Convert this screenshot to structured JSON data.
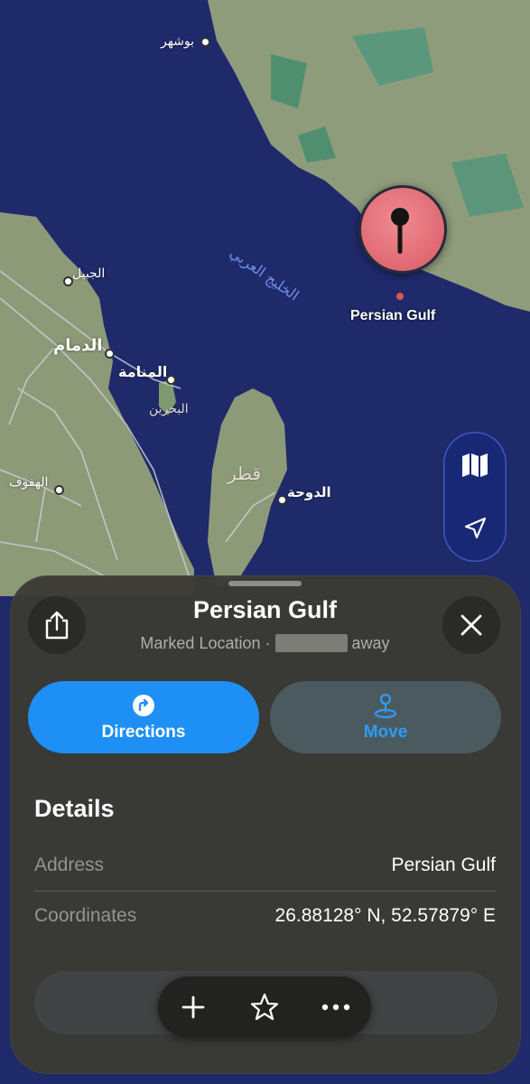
{
  "map": {
    "labels": {
      "bushehr": "بوشهر",
      "jubail": "الجبيل",
      "dammam": "الدمام",
      "manama": "المنامة",
      "bahrain": "البحرين",
      "hofuf": "الهفوف",
      "qatar": "قطر",
      "doha": "الدوحة",
      "gulf_sea_label": "الخليج العربي"
    },
    "pin": {
      "title": "Persian Gulf",
      "color": "#e0525b"
    },
    "colors": {
      "water": "#1f2a6b",
      "land": "#8d9a78",
      "accent": "#1e8ff5"
    }
  },
  "map_controls": {
    "map_mode_icon": "map-icon",
    "location_icon": "location-arrow-icon"
  },
  "sheet": {
    "title": "Persian Gulf",
    "subtitle_prefix": "Marked Location ·",
    "subtitle_suffix": "away",
    "share_icon": "share-icon",
    "close_icon": "close-icon",
    "actions": {
      "directions": "Directions",
      "move": "Move"
    },
    "details": {
      "heading": "Details",
      "rows": [
        {
          "label": "Address",
          "value": "Persian Gulf"
        },
        {
          "label": "Coordinates",
          "value": "26.88128° N, 52.57879° E"
        }
      ]
    },
    "toolbar": {
      "add_icon": "plus-icon",
      "favorite_icon": "star-icon",
      "more_icon": "ellipsis-icon"
    }
  }
}
